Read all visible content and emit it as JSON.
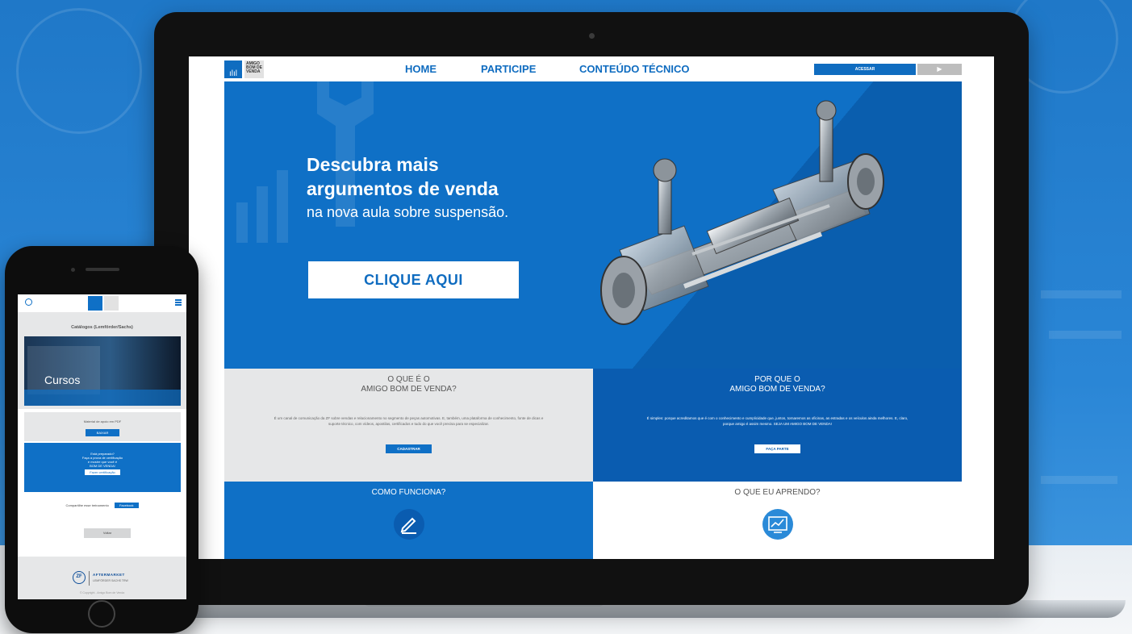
{
  "laptop_site": {
    "logo": {
      "mark": "ılıl",
      "text_lines": [
        "AMIGO",
        "BOM DE",
        "VENDA"
      ]
    },
    "nav": {
      "home": "HOME",
      "participe": "PARTICIPE",
      "conteudo": "CONTEÚDO TÉCNICO"
    },
    "acessar_label": "ACESSAR",
    "youtube_icon": "▶",
    "hero": {
      "title_line1": "Descubra mais",
      "title_line2": "argumentos de venda",
      "subtitle": "na nova aula sobre suspensão.",
      "cta_label": "CLIQUE AQUI"
    },
    "sections": {
      "o_que_e": {
        "title_line1": "O QUE É O",
        "title_line2": "AMIGO BOM DE VENDA?",
        "body": "É um canal de comunicação da ZF sobre vendas e relacionamento no segmento de peças automotivas. E, também, uma plataforma de conhecimento, fonte de dicas e suporte técnico, com vídeos, apostilas, certificados e tudo do que você precisa para se especializar.",
        "button": "CADASTRAR"
      },
      "por_que": {
        "title_line1": "POR QUE O",
        "title_line2": "AMIGO BOM DE VENDA?",
        "body": "É simples: porque acreditamos que é com o conhecimento e cumplicidade que, juntos, tornaremos as oficinas, as estradas e os veículos ainda melhores. E, claro, porque amigo é assim mesmo. SEJA UM AMIGO BOM DE VENDA!",
        "button": "FAÇA PARTE"
      },
      "como_funciona": {
        "title": "COMO FUNCIONA?",
        "icon": "pencil-icon"
      },
      "o_que_aprendo": {
        "title": "O QUE EU APRENDO?",
        "icon": "chart-icon"
      }
    }
  },
  "phone_site": {
    "catalog_title": "Catálogos (Lemförder/Sachs)",
    "banner_label": "Cursos",
    "support_text": "Material de apoio em PDF",
    "support_button": "BAIXAR",
    "cert_lines": [
      "Está preparado?",
      "Faça a prova de certificação",
      "e mostre que você é",
      "BOM DE VENDA!"
    ],
    "cert_button": "Fazer certificação",
    "share_text": "Compartilhe esse treinamento",
    "share_button": "Facebook",
    "back_button": "Voltar",
    "footer_brand": "ZF",
    "footer_text": "AFTERMARKET",
    "footer_sub": "LEMFÖRDER SACHS TRW",
    "footer_note": "© Copyright - Amigo Bom de Venda"
  },
  "colors": {
    "brand_blue": "#0f70c6",
    "dark_blue": "#0a5cb0",
    "light_gray": "#e6e7e8"
  }
}
